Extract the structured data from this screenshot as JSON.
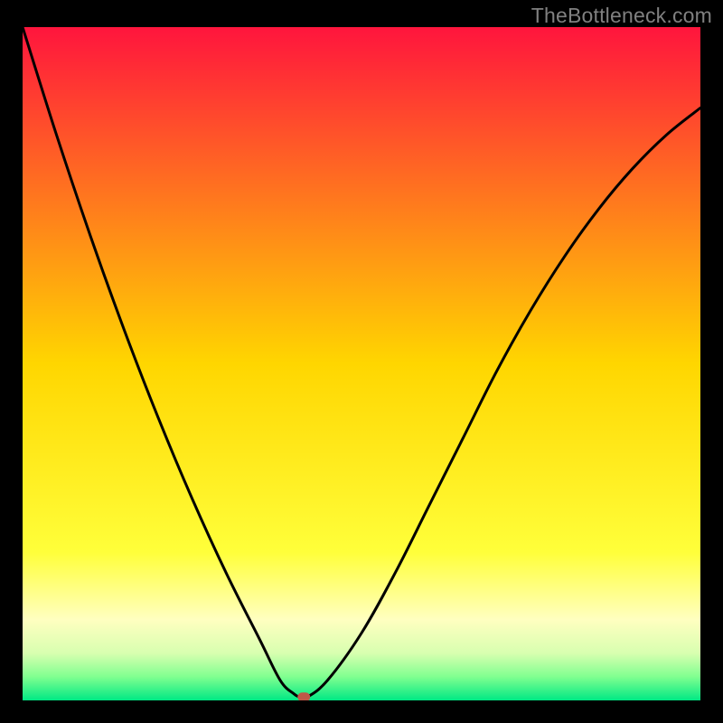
{
  "watermark": "TheBottleneck.com",
  "chart_data": {
    "type": "line",
    "title": "",
    "xlabel": "",
    "ylabel": "",
    "xlim": [
      0,
      100
    ],
    "ylim": [
      0,
      100
    ],
    "grid": false,
    "series": [
      {
        "name": "curve",
        "x": [
          0,
          5,
          10,
          15,
          20,
          25,
          30,
          35,
          38,
          40,
          41,
          42,
          45,
          50,
          55,
          60,
          65,
          70,
          75,
          80,
          85,
          90,
          95,
          100
        ],
        "values": [
          100,
          84,
          69,
          55,
          42,
          30,
          19,
          9,
          3,
          1,
          0.5,
          0.5,
          3,
          10,
          19,
          29,
          39,
          49,
          58,
          66,
          73,
          79,
          84,
          88
        ]
      }
    ],
    "marker": {
      "x": 41.5,
      "y": 0.5
    },
    "background_gradient": {
      "stops": [
        {
          "offset": 0.0,
          "color": "#ff153d"
        },
        {
          "offset": 0.5,
          "color": "#ffd600"
        },
        {
          "offset": 0.78,
          "color": "#ffff3a"
        },
        {
          "offset": 0.88,
          "color": "#ffffc0"
        },
        {
          "offset": 0.93,
          "color": "#d8ffb0"
        },
        {
          "offset": 0.965,
          "color": "#80ff90"
        },
        {
          "offset": 1.0,
          "color": "#00e884"
        }
      ]
    },
    "marker_color": "#c05848",
    "line_color": "#000000"
  }
}
